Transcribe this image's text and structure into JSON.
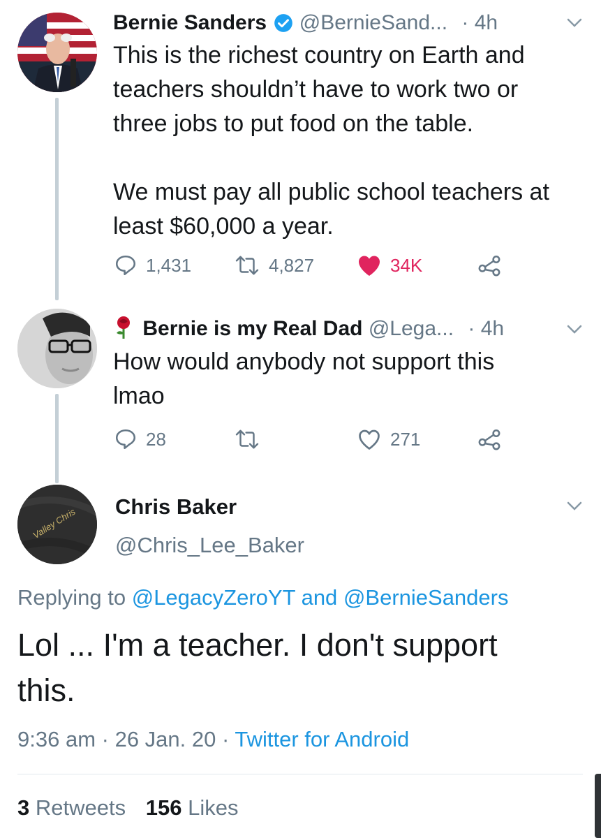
{
  "tweet1": {
    "display_name": "Bernie Sanders",
    "handle": "@BernieSand...",
    "time": "· 4h",
    "text_lines": [
      "This is the richest country on Earth and",
      "teachers shouldn’t have to work two or",
      "three jobs to put food on the table.",
      "",
      "We must pay all public school teachers at",
      "least $60,000 a year."
    ],
    "replies": "1,431",
    "retweets": "4,827",
    "likes": "34K",
    "liked": true
  },
  "tweet2": {
    "display_name": "Bernie is my Real Dad",
    "handle": "@Lega...",
    "time": "· 4h",
    "text_lines": [
      "How would anybody not support this",
      "lmao"
    ],
    "replies": "28",
    "retweets": "",
    "likes": "271"
  },
  "main_tweet": {
    "display_name": "Chris Baker",
    "handle": "@Chris_Lee_Baker",
    "avatar_text": "Valley Chris",
    "replying_prefix": "Replying to",
    "replying_user1": "@LegacyZeroYT",
    "replying_and": "and",
    "replying_user2": "@BernieSanders",
    "text_lines": [
      "Lol ... I'm a teacher. I don't support",
      "this."
    ],
    "time": "9:36 am",
    "date": "· 26 Jan. 20 ·",
    "source": "Twitter for Android",
    "retweet_count": "3",
    "retweet_label": "Retweets",
    "like_count": "156",
    "like_label": "Likes"
  },
  "colors": {
    "accent": "#1b95e0",
    "like_red": "#e0245e",
    "muted": "#657786",
    "verified": "#1da1f2"
  }
}
